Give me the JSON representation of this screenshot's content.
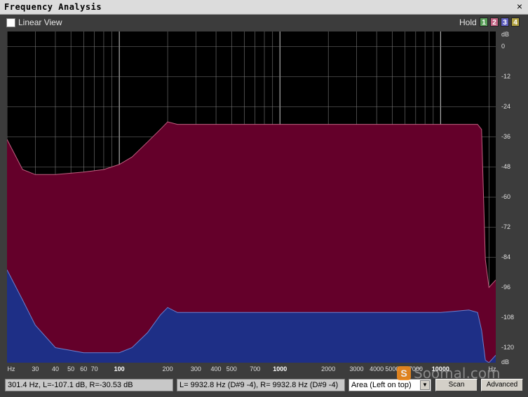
{
  "window": {
    "title": "Frequency Analysis",
    "close_glyph": "×"
  },
  "toolbar": {
    "linear_view_label": "Linear View",
    "linear_view_checked": false,
    "hold_label": "Hold",
    "hold_buttons": [
      {
        "label": "1",
        "color": "#5aa05a"
      },
      {
        "label": "2",
        "color": "#c06080"
      },
      {
        "label": "3",
        "color": "#6060c0"
      },
      {
        "label": "4",
        "color": "#b0a040"
      }
    ]
  },
  "chart_data": {
    "type": "area",
    "x_scale": "log",
    "xlim": [
      20,
      22050
    ],
    "ylim": [
      -126,
      6
    ],
    "x_unit_label": "Hz",
    "y_unit_label": "dB",
    "y_ticks": [
      0,
      -12,
      -24,
      -36,
      -48,
      -60,
      -72,
      -84,
      -96,
      -108,
      -120
    ],
    "x_ticks": [
      {
        "value": 30,
        "label": "30"
      },
      {
        "value": 40,
        "label": "40"
      },
      {
        "value": 50,
        "label": "50"
      },
      {
        "value": 60,
        "label": "60"
      },
      {
        "value": 70,
        "label": "70"
      },
      {
        "value": 100,
        "label": "100",
        "major": true
      },
      {
        "value": 200,
        "label": "200"
      },
      {
        "value": 300,
        "label": "300"
      },
      {
        "value": 400,
        "label": "400"
      },
      {
        "value": 500,
        "label": "500"
      },
      {
        "value": 700,
        "label": "700"
      },
      {
        "value": 1000,
        "label": "1000",
        "major": true
      },
      {
        "value": 2000,
        "label": "2000"
      },
      {
        "value": 3000,
        "label": "3000"
      },
      {
        "value": 4000,
        "label": "4000"
      },
      {
        "value": 5000,
        "label": "5000"
      },
      {
        "value": 7000,
        "label": "7000"
      },
      {
        "value": 10000,
        "label": "10000",
        "major": true
      }
    ],
    "grid": true,
    "series": [
      {
        "color": "#64002a",
        "stroke": "#c06080",
        "points": [
          [
            20,
            -37
          ],
          [
            25,
            -49
          ],
          [
            30,
            -51
          ],
          [
            40,
            -51
          ],
          [
            60,
            -50
          ],
          [
            80,
            -49
          ],
          [
            100,
            -47
          ],
          [
            120,
            -44
          ],
          [
            150,
            -38
          ],
          [
            180,
            -33
          ],
          [
            200,
            -30
          ],
          [
            230,
            -31
          ],
          [
            400,
            -31
          ],
          [
            1000,
            -31
          ],
          [
            5000,
            -31
          ],
          [
            15000,
            -31
          ],
          [
            17000,
            -31
          ],
          [
            18000,
            -33
          ],
          [
            19000,
            -85
          ],
          [
            20000,
            -96
          ],
          [
            22050,
            -93
          ]
        ]
      },
      {
        "color": "#1e2f86",
        "stroke": "#6a80d0",
        "points": [
          [
            20,
            -89
          ],
          [
            25,
            -101
          ],
          [
            30,
            -111
          ],
          [
            40,
            -120
          ],
          [
            60,
            -122
          ],
          [
            80,
            -122
          ],
          [
            100,
            -122
          ],
          [
            120,
            -120
          ],
          [
            150,
            -114
          ],
          [
            180,
            -107
          ],
          [
            200,
            -104
          ],
          [
            230,
            -106
          ],
          [
            1000,
            -106
          ],
          [
            5000,
            -106
          ],
          [
            10000,
            -106
          ],
          [
            15000,
            -105
          ],
          [
            17000,
            -106
          ],
          [
            18000,
            -113
          ],
          [
            19000,
            -125
          ],
          [
            20000,
            -126
          ],
          [
            22050,
            -123
          ]
        ]
      }
    ]
  },
  "status": {
    "cursor_readout": "301.4 Hz, L=-107.1 dB, R=-30.53 dB",
    "peak_readout": "L= 9932.8 Hz (D#9 -4), R= 9932.8 Hz (D#9 -4)",
    "display_mode": "Area (Left on top)",
    "scan_label": "Scan",
    "advanced_label": "Advanced"
  },
  "watermark": {
    "logo_glyph": "S",
    "text": "Soomal.com"
  }
}
